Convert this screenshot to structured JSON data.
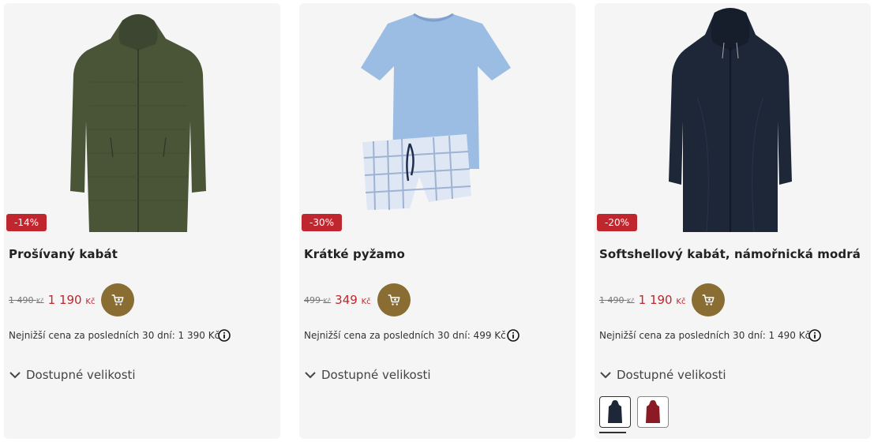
{
  "products": [
    {
      "badge": "-14%",
      "title": "Prošívaný kabát",
      "old_price": "1 490",
      "old_currency": "Kč",
      "new_price": "1 190",
      "new_currency": "Kč",
      "lowest_price_text": "Nejnižší cena za posledních 30 dní: 1 390 Kč",
      "sizes_label": "Dostupné velikosti",
      "colors": {
        "main": "#4a5538"
      }
    },
    {
      "badge": "-30%",
      "title": "Krátké pyžamo",
      "old_price": "499",
      "old_currency": "Kč",
      "new_price": "349",
      "new_currency": "Kč",
      "lowest_price_text": "Nejnižší cena za posledních 30 dní: 499 Kč",
      "sizes_label": "Dostupné velikosti",
      "colors": {
        "main": "#9bbde3"
      }
    },
    {
      "badge": "-20%",
      "title": "Softshellový kabát, námořnická modrá",
      "old_price": "1 490",
      "old_currency": "Kč",
      "new_price": "1 190",
      "new_currency": "Kč",
      "lowest_price_text": "Nejnižší cena za posledních 30 dní: 1 490 Kč",
      "sizes_label": "Dostupné velikosti",
      "colors": {
        "main": "#1e2738"
      },
      "swatches": [
        {
          "name": "navy",
          "color": "#1e2738"
        },
        {
          "name": "burgundy",
          "color": "#8c1a25"
        }
      ]
    }
  ],
  "theme": {
    "badge_color": "#c0262d",
    "price_color": "#c0262d",
    "cart_button_color": "#8a6d33",
    "card_background": "#f5f5f5"
  },
  "icons": {
    "cart": "cart-icon",
    "info": "info-icon",
    "chevron": "chevron-down-icon"
  }
}
